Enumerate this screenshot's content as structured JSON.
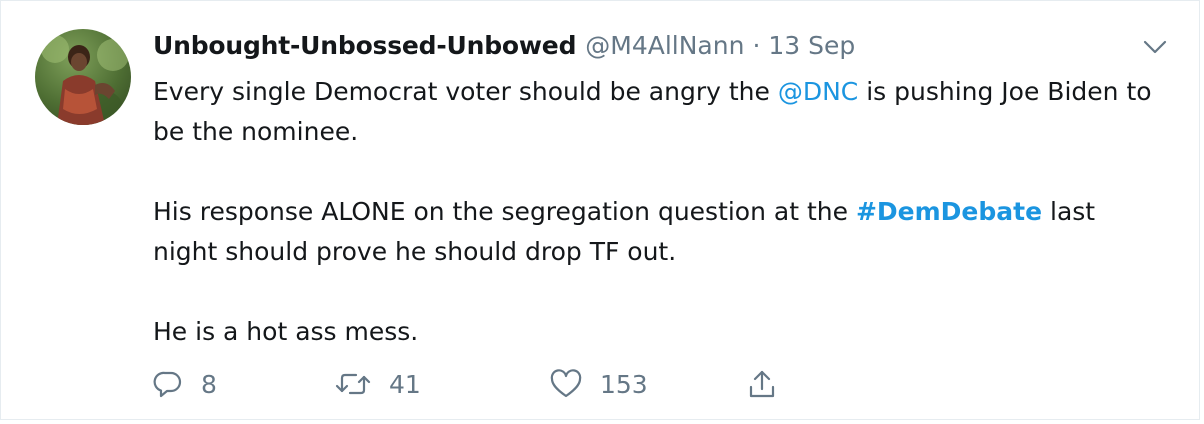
{
  "tweet": {
    "display_name": "Unbought-Unbossed-Unbowed",
    "handle": "@M4AllNann",
    "separator": "·",
    "date": "13 Sep",
    "paragraphs": {
      "p1_pre": "Every single Democrat voter should be angry the ",
      "p1_mention": "@DNC",
      "p1_post": " is pushing Joe Biden to be the nominee.",
      "p2_pre": "His response ALONE on the segregation question at the ",
      "p2_hashtag": "#DemDebate",
      "p2_post": " last night should prove he should drop TF out.",
      "p3": "He is a hot ass mess."
    },
    "actions": {
      "reply_count": "8",
      "retweet_count": "41",
      "like_count": "153"
    }
  },
  "icons": {
    "menu": "chevron-down-icon",
    "reply": "reply-icon",
    "retweet": "retweet-icon",
    "like": "heart-icon",
    "share": "share-icon"
  },
  "colors": {
    "link": "#1b95e0",
    "secondary_text": "#657786",
    "primary_text": "#14171a",
    "border": "#e6ecf0"
  }
}
